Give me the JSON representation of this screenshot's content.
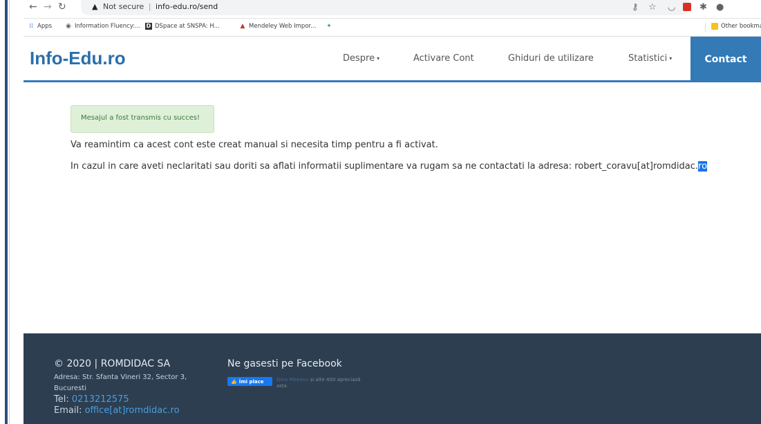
{
  "browser": {
    "security_label": "Not secure",
    "separator": "|",
    "url": "info-edu.ro/send",
    "bookmarks": [
      {
        "label": "Apps"
      },
      {
        "label": "Information Fluency:..."
      },
      {
        "label": "DSpace at SNSPA: H..."
      },
      {
        "label": "Mendeley Web Impor..."
      }
    ],
    "other_bookmarks": "Other bookmar"
  },
  "site": {
    "logo": "Info-Edu.ro",
    "nav": [
      {
        "label": "Despre",
        "dropdown": true
      },
      {
        "label": "Activare Cont"
      },
      {
        "label": "Ghiduri de utilizare"
      },
      {
        "label": "Statistici",
        "dropdown": true
      },
      {
        "label": "Contact",
        "active": true
      }
    ]
  },
  "main": {
    "alert": "Mesajul a fost transmis cu succes!",
    "para1": "Va reamintim ca acest cont este creat manual si necesita timp pentru a fi activat.",
    "para2_prefix": "In cazul in care aveti neclaritati sau doriti sa aflati informatii suplimentare va rugam sa ne contactati la adresa: robert_coravu[at]romdidac.",
    "para2_selected": "ro"
  },
  "footer": {
    "copyright": "© 2020 | ROMDIDAC SA",
    "address_line1": "Adresa: Str. Sfanta Vineri 32, Sector 3,",
    "address_line2": "Bucuresti",
    "tel_label": "Tel:",
    "tel_value": "0213212575",
    "email_label": "Email:",
    "email_value": "office[at]romdidac.ro",
    "facebook_title": "Ne gasesti pe Facebook",
    "like_button": "Îmi place",
    "like_name": "Gina Mireanu",
    "like_text": "și alte 400 apreciază",
    "like_text2": "asta"
  },
  "colors": {
    "brand": "#337ab7",
    "footer_bg": "#2c3e50",
    "alert_bg": "#dff0d8"
  }
}
